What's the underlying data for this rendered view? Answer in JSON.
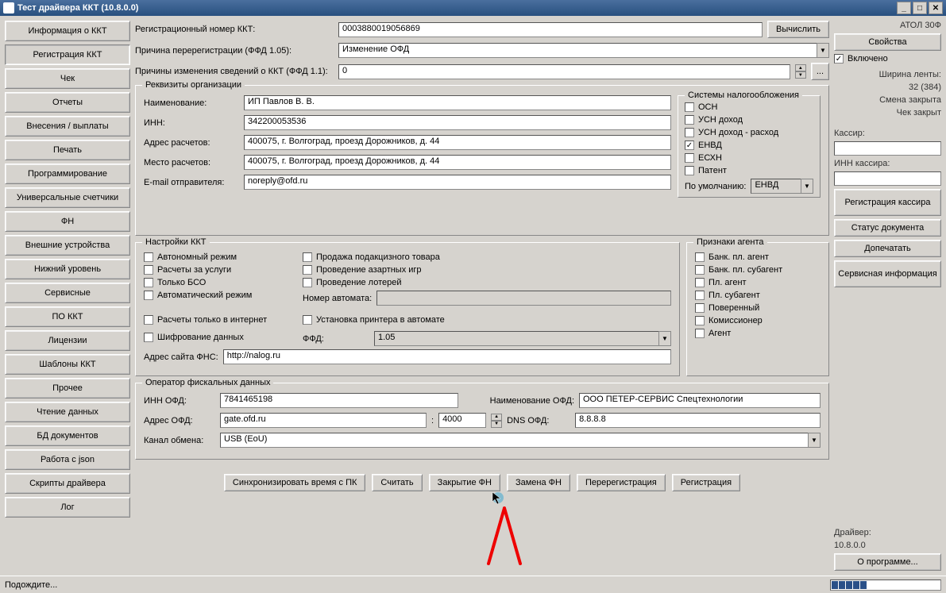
{
  "window": {
    "title": "Тест драйвера ККТ (10.8.0.0)",
    "min": "_",
    "max": "□",
    "close": "✕"
  },
  "nav": {
    "items": [
      "Информация о ККТ",
      "Регистрация ККТ",
      "Чек",
      "Отчеты",
      "Внесения / выплаты",
      "Печать",
      "Программирование",
      "Универсальные счетчики",
      "ФН",
      "Внешние устройства",
      "Нижний уровень",
      "Сервисные",
      "ПО ККТ",
      "Лицензии",
      "Шаблоны ККТ",
      "Прочее",
      "Чтение данных",
      "БД документов",
      "Работа с json",
      "Скрипты драйвера",
      "Лог"
    ],
    "selected": "Регистрация ККТ"
  },
  "top": {
    "reg_num_label": "Регистрационный номер ККТ:",
    "reg_num": "0003880019056869",
    "calc_btn": "Вычислить",
    "rereg_reason_label": "Причина перерегистрации (ФФД 1.05):",
    "rereg_reason": "Изменение ОФД",
    "change_reason_label": "Причины изменения сведений о ККТ (ФФД 1.1):",
    "change_reason": "0",
    "dots_btn": "..."
  },
  "org": {
    "group": "Реквизиты организации",
    "name_label": "Наименование:",
    "name": "ИП Павлов В. В.",
    "inn_label": "ИНН:",
    "inn": "342200053536",
    "addr_label": "Адрес расчетов:",
    "addr": "400075, г. Волгоград, проезд Дорожников, д. 44",
    "place_label": "Место расчетов:",
    "place": "400075, г. Волгоград, проезд Дорожников, д. 44",
    "email_label": "E-mail отправителя:",
    "email": "noreply@ofd.ru"
  },
  "tax": {
    "group": "Системы налогообложения",
    "items": [
      "ОСН",
      "УСН доход",
      "УСН доход - расход",
      "ЕНВД",
      "ЕСХН",
      "Патент"
    ],
    "checked": "ЕНВД",
    "default_label": "По умолчанию:",
    "default": "ЕНВД"
  },
  "kkt": {
    "group": "Настройки ККТ",
    "col1": [
      "Автономный режим",
      "Расчеты за услуги",
      "Только БСО",
      "Автоматический режим"
    ],
    "col2": [
      "Продажа подакцизного товара",
      "Проведение азартных игр",
      "Проведение лотерей"
    ],
    "nomer_label": "Номер автомата:",
    "nomer": "",
    "internet": "Расчеты только в интернет",
    "printer": "Установка принтера в автомате",
    "encrypt": "Шифрование данных",
    "ffd_label": "ФФД:",
    "ffd": "1.05",
    "fns_label": "Адрес сайта ФНС:",
    "fns": "http://nalog.ru"
  },
  "agent": {
    "group": "Признаки агента",
    "items": [
      "Банк. пл. агент",
      "Банк. пл. субагент",
      "Пл. агент",
      "Пл. субагент",
      "Поверенный",
      "Комиссионер",
      "Агент"
    ]
  },
  "ofd": {
    "group": "Оператор фискальных данных",
    "inn_label": "ИНН ОФД:",
    "inn": "7841465198",
    "name_label": "Наименование ОФД:",
    "name": "ООО ПЕТЕР-СЕРВИС Спецтехнологии",
    "addr_label": "Адрес ОФД:",
    "addr": "gate.ofd.ru",
    "port": "4000",
    "dns_label": "DNS ОФД:",
    "dns": "8.8.8.8",
    "channel_label": "Канал обмена:",
    "channel": "USB (EoU)"
  },
  "bottom": {
    "sync": "Синхронизировать время с ПК",
    "read": "Считать",
    "close_fn": "Закрытие ФН",
    "replace_fn": "Замена ФН",
    "rereg": "Перерегистрация",
    "reg": "Регистрация"
  },
  "right": {
    "model": "АТОЛ 30Ф",
    "props_btn": "Свойства",
    "enabled": "Включено",
    "tape_label": "Ширина ленты:",
    "tape": "32 (384)",
    "shift": "Смена закрыта",
    "receipt": "Чек закрыт",
    "cashier_label": "Кассир:",
    "cashier_inn_label": "ИНН кассира:",
    "reg_cashier": "Регистрация кассира",
    "doc_status": "Статус документа",
    "print_more": "Допечатать",
    "service_info": "Сервисная информация",
    "driver_label": "Драйвер:",
    "driver_ver": "10.8.0.0",
    "about": "О программе..."
  },
  "status": {
    "text": "Подождите..."
  }
}
